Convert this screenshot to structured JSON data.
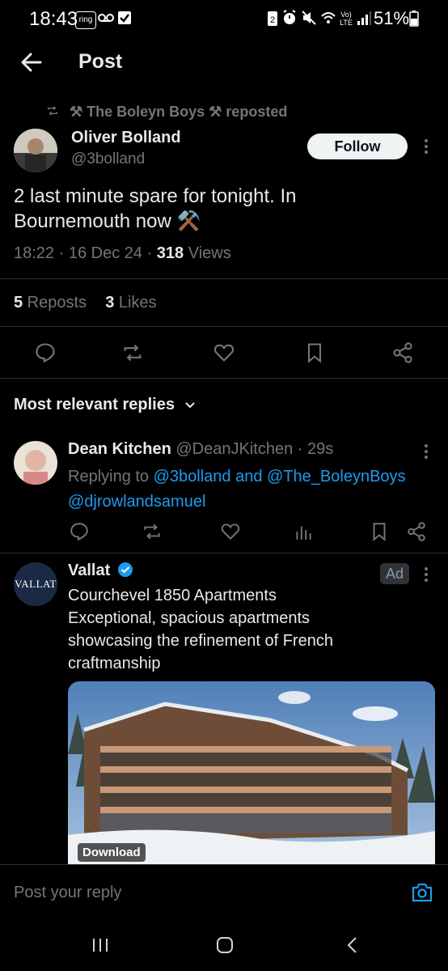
{
  "status_bar": {
    "time": "18:43",
    "ring_label": "ring",
    "battery": "51%"
  },
  "header": {
    "title": "Post"
  },
  "post": {
    "repost_by": "⚒ The Boleyn Boys ⚒ reposted",
    "author_name": "Oliver Bolland",
    "author_handle": "@3bolland",
    "follow_label": "Follow",
    "text_line1": "2 last minute spare for tonight. In",
    "text_line2": "Bournemouth now ⚒️",
    "time": "18:22 · 16 Dec 24 · ",
    "views_count": "318",
    "views_label": " Views",
    "reposts_count": "5",
    "reposts_label": " Reposts",
    "likes_count": "3",
    "likes_label": " Likes"
  },
  "replies_sort": {
    "label": "Most relevant replies"
  },
  "reply": {
    "name": "Dean Kitchen",
    "handle_time": "@DeanJKitchen · 29s",
    "replying_prefix": "Replying to ",
    "replying_line1": "@3bolland and @The_BoleynBoys",
    "replying_line2": "@djrowlandsamuel"
  },
  "ad": {
    "logo_text": "VALLAT",
    "name": "Vallat",
    "badge": "Ad",
    "line1": "Courchevel 1850 Apartments",
    "line2": "Exceptional, spacious apartments",
    "line3": "showcasing the refinement of French",
    "line4": "craftmanship",
    "download_label": "Download"
  },
  "reply_input": {
    "placeholder": "Post your reply"
  },
  "colors": {
    "accent": "#1d9bf0",
    "muted": "#71767b",
    "background": "#000000"
  },
  "icons": [
    "back-arrow-icon",
    "repost-icon",
    "more-icon",
    "reply-icon",
    "like-icon",
    "bookmark-icon",
    "share-icon",
    "analytics-icon",
    "verified-icon",
    "chevron-down-icon",
    "camera-icon",
    "recents-icon",
    "home-icon",
    "nav-back-icon"
  ]
}
